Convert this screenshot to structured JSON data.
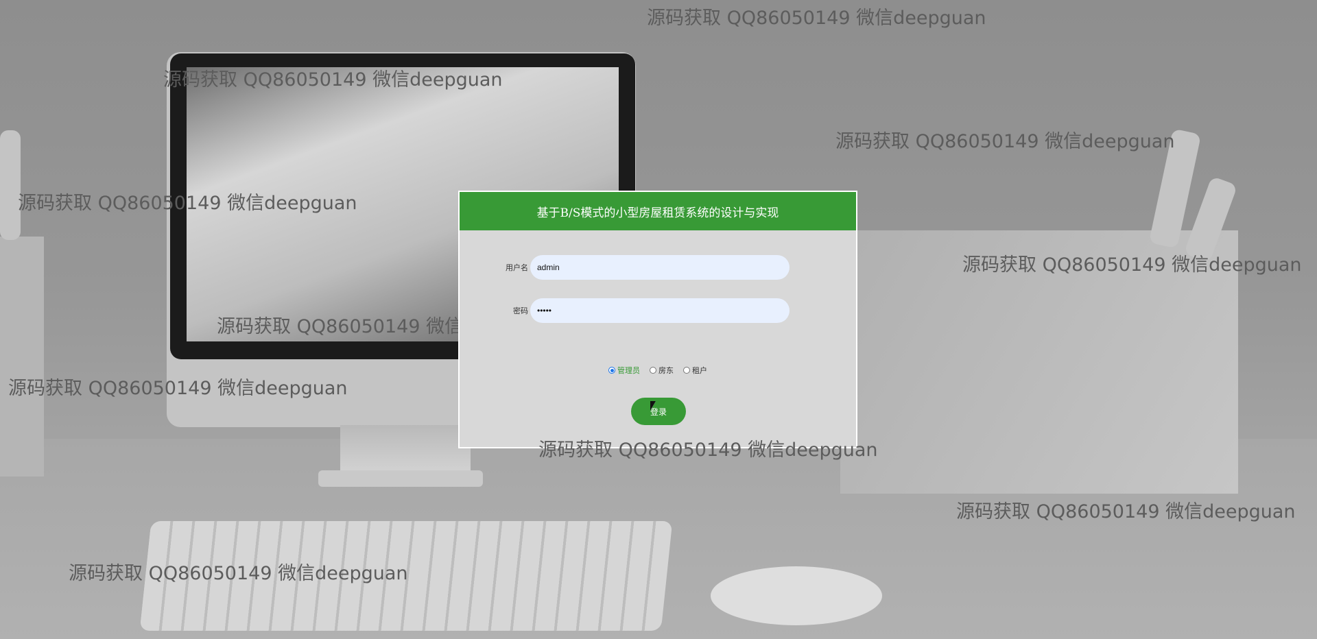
{
  "watermark_text": "源码获取 QQ86050149 微信deepguan",
  "login": {
    "title": "基于B/S模式的小型房屋租赁系统的设计与实现",
    "username_label": "用户名",
    "username_value": "admin",
    "password_label": "密码",
    "password_value": "•••••",
    "roles": [
      {
        "label": "管理员",
        "selected": true
      },
      {
        "label": "房东",
        "selected": false
      },
      {
        "label": "租户",
        "selected": false
      }
    ],
    "login_button": "登录"
  },
  "colors": {
    "accent": "#389a36",
    "panel_bg": "#d8d8d8",
    "input_bg": "#e8f0fe"
  }
}
